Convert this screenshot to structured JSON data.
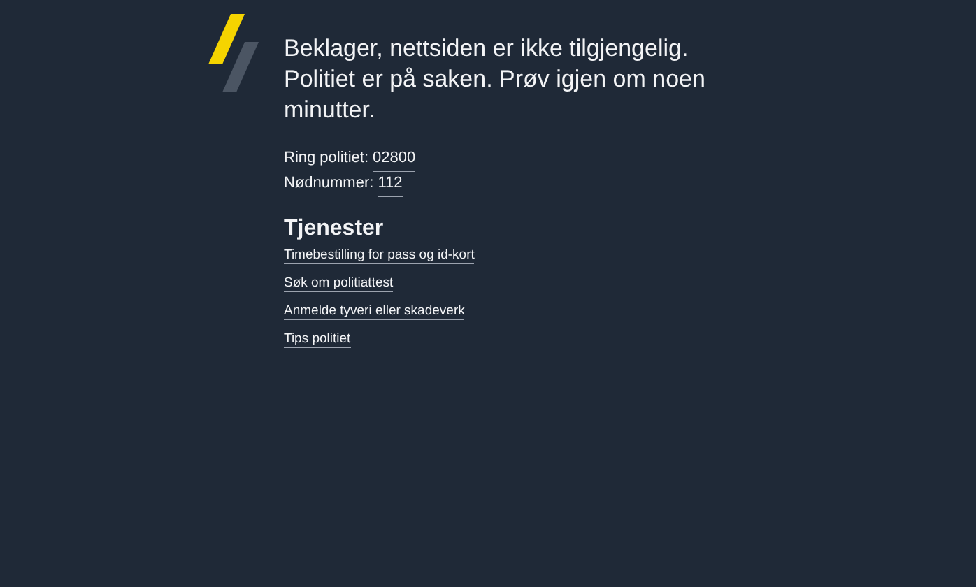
{
  "message": "Beklager, nettsiden er ikke tilgjengelig. Politiet er på saken. Prøv igjen om noen minutter.",
  "contacts": [
    {
      "label": "Ring politiet:",
      "number": "02800"
    },
    {
      "label": "Nødnummer:",
      "number": "112"
    }
  ],
  "services": {
    "heading": "Tjenester",
    "links": [
      "Timebestilling for pass og id-kort",
      "Søk om politiattest",
      "Anmelde tyveri eller skadeverk",
      "Tips politiet"
    ]
  }
}
